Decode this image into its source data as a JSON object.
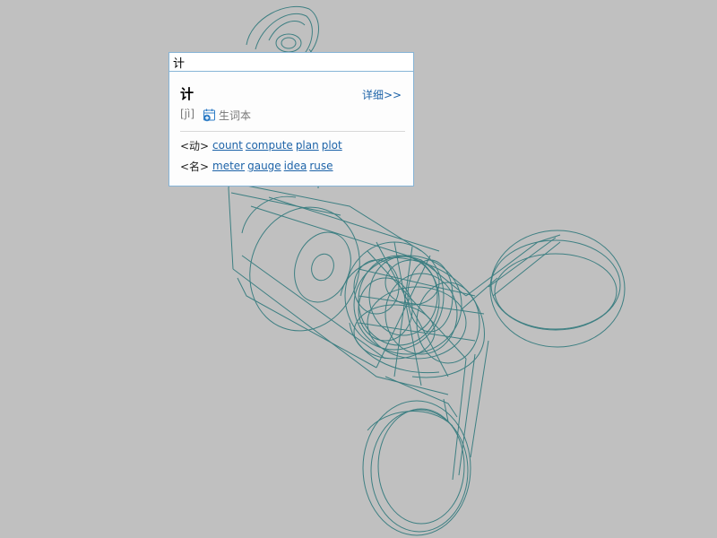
{
  "lookup": {
    "input_value": "计",
    "headword": "计",
    "detail_label": "详细>>",
    "pinyin": "[jì]",
    "wordbook_label": "生词本",
    "wordbook_icon": "calendar-add-icon",
    "senses": [
      {
        "pos": "<动>",
        "translations": [
          "count",
          "compute",
          "plan",
          "plot"
        ]
      },
      {
        "pos": "<名>",
        "translations": [
          "meter",
          "gauge",
          "idea",
          "ruse"
        ]
      }
    ]
  },
  "colors": {
    "background": "#c0c0c0",
    "wireframe": "#3d7f82",
    "popup_border": "#86b4d6",
    "link": "#1d63a8"
  }
}
